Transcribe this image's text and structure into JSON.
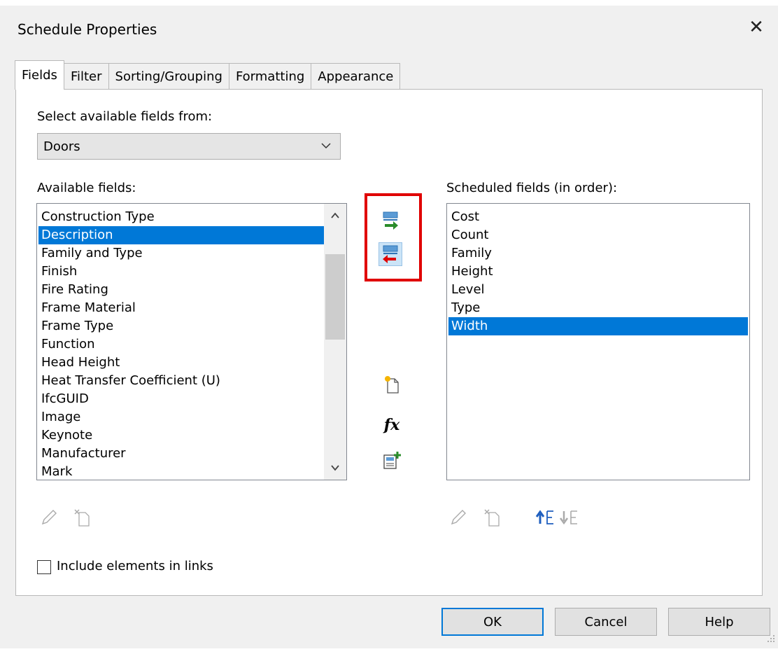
{
  "window": {
    "title": "Schedule Properties",
    "close_glyph": "✕"
  },
  "tabs": [
    {
      "label": "Fields",
      "active": true
    },
    {
      "label": "Filter",
      "active": false
    },
    {
      "label": "Sorting/Grouping",
      "active": false
    },
    {
      "label": "Formatting",
      "active": false
    },
    {
      "label": "Appearance",
      "active": false
    }
  ],
  "fields_tab": {
    "source_label": "Select available fields from:",
    "source_value": "Doors",
    "available_label": "Available fields:",
    "available_fields": [
      "Construction Type",
      "Description",
      "Family and Type",
      "Finish",
      "Fire Rating",
      "Frame Material",
      "Frame Type",
      "Function",
      "Head Height",
      "Heat Transfer Coefficient (U)",
      "IfcGUID",
      "Image",
      "Keynote",
      "Manufacturer",
      "Mark"
    ],
    "available_selected": "Description",
    "scheduled_label": "Scheduled fields (in order):",
    "scheduled_fields": [
      "Cost",
      "Count",
      "Family",
      "Height",
      "Level",
      "Type",
      "Width"
    ],
    "scheduled_selected": "Width",
    "include_links_label": "Include elements in links",
    "include_links_checked": false
  },
  "buttons": {
    "ok": "OK",
    "cancel": "Cancel",
    "help": "Help"
  },
  "icons": {
    "add_parameter": "add-field-arrow-icon",
    "remove_parameter": "remove-field-arrow-icon",
    "new_parameter": "new-parameter-icon",
    "calculated_value": "fx-calculated-value-icon",
    "combine_parameters": "combine-parameters-icon",
    "edit": "pencil-icon",
    "delete": "delete-parameter-icon",
    "move_up": "move-up-icon",
    "move_down": "move-down-icon"
  },
  "fx_text": "fx",
  "colors": {
    "selection": "#0078d7",
    "highlight": "#e00000",
    "arrow_green": "#2a8c2a",
    "arrow_red": "#e00000"
  }
}
